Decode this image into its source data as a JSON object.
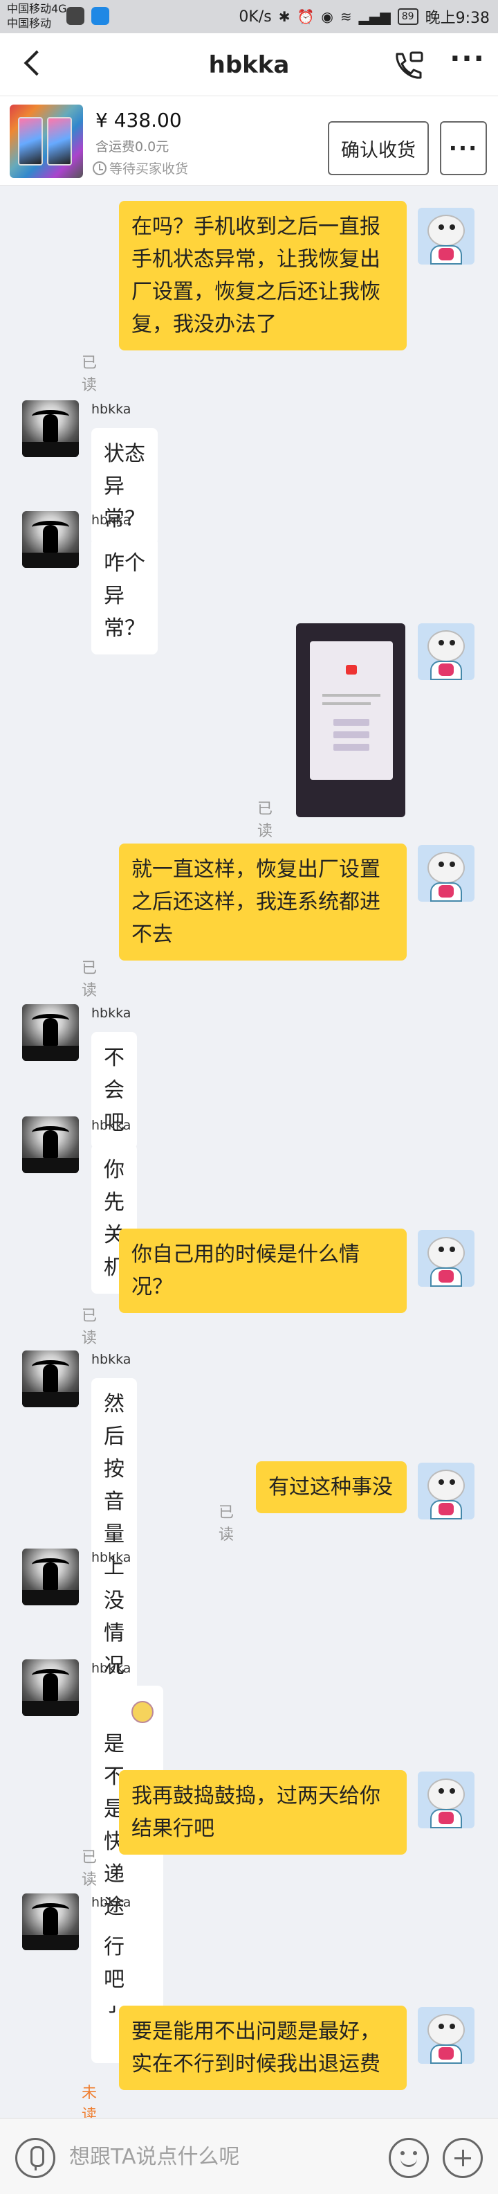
{
  "status_bar": {
    "carrier_1": "中国移动4G",
    "carrier_2": "中国移动",
    "network_speed": "0K/s",
    "battery": "89",
    "time": "晚上9:38"
  },
  "header": {
    "title": "hbkka"
  },
  "product": {
    "price": "¥ 438.00",
    "shipping": "含运费0.0元",
    "status": "等待买家收货",
    "confirm_label": "确认收货"
  },
  "conversation": {
    "sender_name": "hbkka",
    "read_label": "已读",
    "unread_label": "未读",
    "messages": [
      {
        "from": "me",
        "text": "在吗？手机收到之后一直报\n手机状态异常，让我恢复出\n厂设置，恢复之后还让我恢\n复，我没办法了",
        "read": "已读"
      },
      {
        "from": "other",
        "name": "hbkka",
        "text": "状态异常？"
      },
      {
        "from": "other",
        "name": "hbkka",
        "text": "咋个异常？"
      },
      {
        "from": "me",
        "type": "image",
        "read": "已读"
      },
      {
        "from": "me",
        "text": "就一直这样，恢复出厂设置\n之后还这样，我连系统都进\n不去",
        "read": "已读"
      },
      {
        "from": "other",
        "name": "hbkka",
        "text": "不会吧"
      },
      {
        "from": "other",
        "name": "hbkka",
        "text": "你先关机"
      },
      {
        "from": "me",
        "text": "你自己用的时候是什么情\n况？",
        "read": "已读"
      },
      {
        "from": "other",
        "name": "hbkka",
        "text": "然后按音量上加开关同时按"
      },
      {
        "from": "me",
        "text": "有过这种事没",
        "read": "已读"
      },
      {
        "from": "other",
        "name": "hbkka",
        "text": "没情况啊"
      },
      {
        "from": "other",
        "name": "hbkka",
        "text": "是不是快递途中磕了"
      },
      {
        "from": "me",
        "text": "我再鼓捣鼓捣，过两天给你\n结果行吧",
        "read": "已读"
      },
      {
        "from": "other",
        "name": "hbkka",
        "text": "行吧"
      },
      {
        "from": "me",
        "text": "要是能用不出问题是最好，\n实在不行到时候我出退运费",
        "read": "未读"
      }
    ]
  },
  "input_bar": {
    "placeholder": "想跟TA说点什么呢"
  },
  "icons": {
    "back": "back-arrow-icon",
    "call": "phone-call-icon",
    "more": "more-dots-icon",
    "voice": "microphone-icon",
    "emoji": "emoji-icon",
    "plus": "plus-icon"
  },
  "colors": {
    "my_bubble": "#ffd43b",
    "other_bubble": "#ffffff",
    "chat_background": "#eff1f5",
    "unread": "#ef7d2e"
  }
}
